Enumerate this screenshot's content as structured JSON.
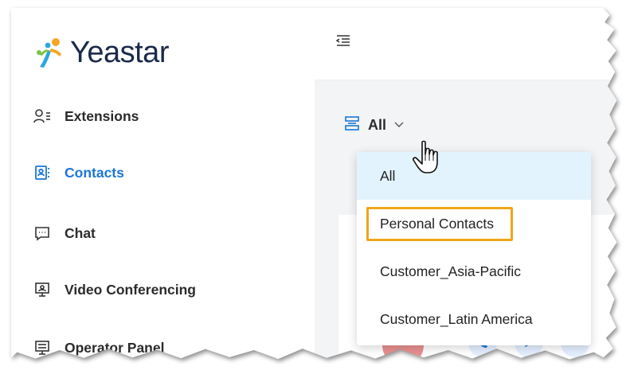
{
  "brand": {
    "name": "Yeastar",
    "accent": "#1c76d6",
    "highlight": "#f0a519"
  },
  "sidebar": {
    "items": [
      {
        "label": "Extensions",
        "icon": "user-list-icon",
        "active": false
      },
      {
        "label": "Contacts",
        "icon": "contacts-icon",
        "active": true
      },
      {
        "label": "Chat",
        "icon": "chat-icon",
        "active": false
      },
      {
        "label": "Video Conferencing",
        "icon": "video-conference-icon",
        "active": false
      },
      {
        "label": "Operator Panel",
        "icon": "operator-panel-icon",
        "active": false
      }
    ]
  },
  "filter": {
    "label": "All"
  },
  "dropdown": {
    "options": [
      {
        "label": "All",
        "selected": true
      },
      {
        "label": "Personal Contacts",
        "highlighted": true
      },
      {
        "label": "Customer_Asia-Pacific"
      },
      {
        "label": "Customer_Latin America"
      }
    ]
  }
}
